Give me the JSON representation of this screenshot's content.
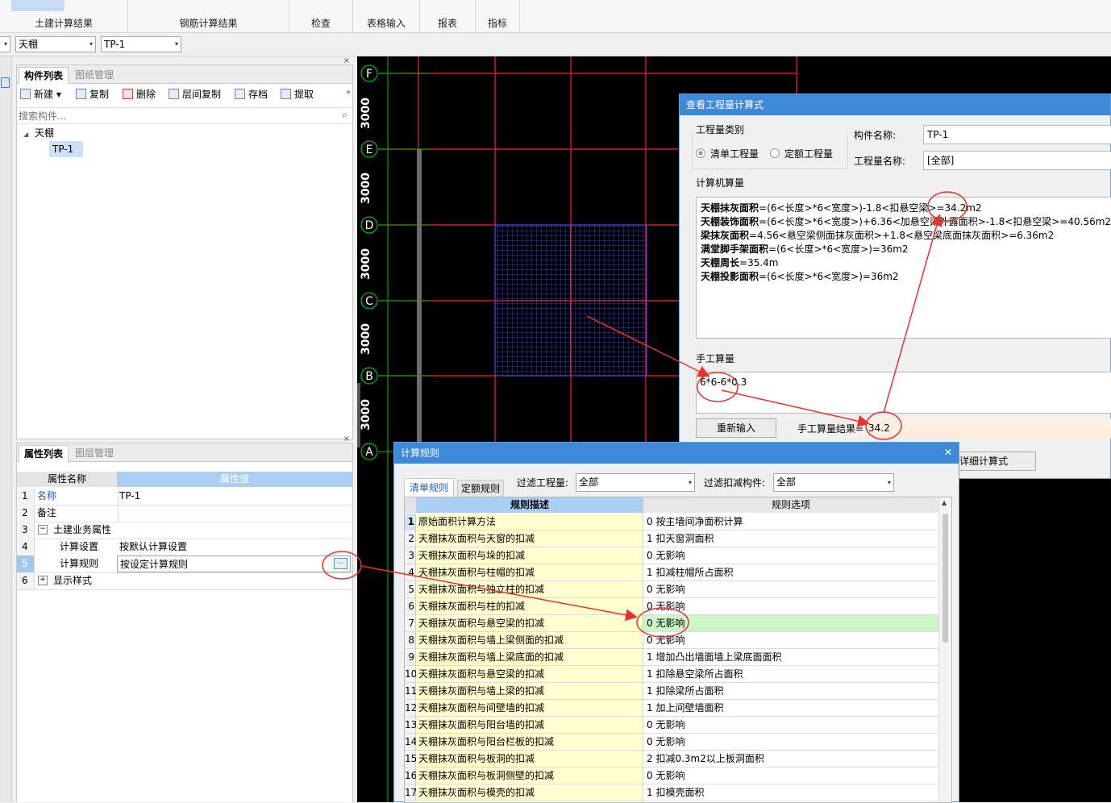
{
  "ribbon": {
    "tabs": [
      "土建计算结果",
      "钢筋计算结果",
      "检查",
      "表格输入",
      "报表",
      "指标"
    ]
  },
  "selectors": {
    "category": "天棚",
    "component": "TP-1"
  },
  "component_panel": {
    "tabs": [
      "构件列表",
      "图纸管理"
    ],
    "toolbar": [
      "新建",
      "复制",
      "删除",
      "层间复制",
      "存档",
      "提取"
    ],
    "search_placeholder": "搜索构件...",
    "tree": {
      "root": "天棚",
      "child": "TP-1"
    }
  },
  "property_panel": {
    "tabs": [
      "属性列表",
      "图层管理"
    ],
    "headers": [
      "属性名称",
      "属性值"
    ],
    "rows": [
      {
        "num": "1",
        "name": "名称",
        "value": "TP-1"
      },
      {
        "num": "2",
        "name": "备注",
        "value": ""
      },
      {
        "num": "3",
        "name": "土建业务属性",
        "value": ""
      },
      {
        "num": "4",
        "name": "计算设置",
        "value": "按默认计算设置"
      },
      {
        "num": "5",
        "name": "计算规则",
        "value": "按设定计算规则"
      },
      {
        "num": "6",
        "name": "显示样式",
        "value": ""
      }
    ],
    "ellipsis": "···"
  },
  "canvas": {
    "axis_labels": [
      "F",
      "E",
      "D",
      "C",
      "B",
      "A"
    ],
    "spacing_labels": [
      "3000",
      "3000",
      "3000",
      "3000",
      "3000"
    ],
    "colors": {
      "grid": "#ff2020",
      "axis": "#00c000",
      "mesh": "#3a4dff"
    }
  },
  "quantity_dialog": {
    "title": "查看工程量计算式",
    "qty_type_label": "工程量类别",
    "radio_list": "清单工程量",
    "radio_quota": "定额工程量",
    "component_name_label": "构件名称:",
    "component_name_value": "TP-1",
    "qty_name_label": "工程量名称:",
    "qty_name_value": "[全部]",
    "computer_label": "计算机算量",
    "formulas": [
      {
        "name": "天棚抹灰面积",
        "expr": "=(6<长度>*6<宽度>)-1.8<扣悬空梁>=34.2m2"
      },
      {
        "name": "天棚装饰面积",
        "expr": "=(6<长度>*6<宽度>)+6.36<加悬空梁外露面积>-1.8<扣悬空梁>=40.56m2"
      },
      {
        "name": "梁抹灰面积",
        "expr": "=4.56<悬空梁侧面抹灰面积>+1.8<悬空梁底面抹灰面积>=6.36m2"
      },
      {
        "name": "满堂脚手架面积",
        "expr": "=(6<长度>*6<宽度>)=36m2"
      },
      {
        "name": "天棚周长",
        "expr": "=35.4m"
      },
      {
        "name": "天棚投影面积",
        "expr": "=(6<长度>*6<宽度>)=36m2"
      }
    ],
    "manual_label": "手工算量",
    "manual_input": "6*6-6*0.3",
    "reinput_button": "重新输入",
    "manual_result_label": "手工算量结果=",
    "manual_result_value": "34.2",
    "detail_button": "示详细计算式"
  },
  "rules_dialog": {
    "title": "计算规则",
    "close": "✕",
    "tabs": [
      "清单规则",
      "定额规则"
    ],
    "filter_qty_label": "过滤工程量:",
    "filter_qty_value": "全部",
    "filter_deduct_label": "过滤扣减构件:",
    "filter_deduct_value": "全部",
    "headers": [
      "规则描述",
      "规则选项"
    ],
    "rows": [
      {
        "num": "1",
        "desc": "原始面积计算方法",
        "opt": "0 按主墙间净面积计算"
      },
      {
        "num": "2",
        "desc": "天棚抹灰面积与天窗的扣减",
        "opt": "1 扣天窗洞面积"
      },
      {
        "num": "3",
        "desc": "天棚抹灰面积与垛的扣减",
        "opt": "0  无影响"
      },
      {
        "num": "4",
        "desc": "天棚抹灰面积与柱帽的扣减",
        "opt": "1 扣减柱帽所占面积"
      },
      {
        "num": "5",
        "desc": "天棚抹灰面积与独立柱的扣减",
        "opt": "0  无影响"
      },
      {
        "num": "6",
        "desc": "天棚抹灰面积与柱的扣减",
        "opt": "0  无影响"
      },
      {
        "num": "7",
        "desc": "天棚抹灰面积与悬空梁的扣减",
        "opt": "0  无影响"
      },
      {
        "num": "8",
        "desc": "天棚抹灰面积与墙上梁侧面的扣减",
        "opt": "0  无影响"
      },
      {
        "num": "9",
        "desc": "天棚抹灰面积与墙上梁底面的扣减",
        "opt": "1 增加凸出墙面墙上梁底面面积"
      },
      {
        "num": "10",
        "desc": "天棚抹灰面积与悬空梁的扣减",
        "opt": "1 扣除悬空梁所占面积"
      },
      {
        "num": "11",
        "desc": "天棚抹灰面积与墙上梁的扣减",
        "opt": "1 扣除梁所占面积"
      },
      {
        "num": "12",
        "desc": "天棚抹灰面积与间壁墙的扣减",
        "opt": "1 加上间壁墙面积"
      },
      {
        "num": "13",
        "desc": "天棚抹灰面积与阳台墙的扣减",
        "opt": "0  无影响"
      },
      {
        "num": "14",
        "desc": "天棚抹灰面积与阳台栏板的扣减",
        "opt": "0  无影响"
      },
      {
        "num": "15",
        "desc": "天棚抹灰面积与板洞的扣减",
        "opt": "2 扣减0.3m2以上板洞面积"
      },
      {
        "num": "16",
        "desc": "天棚抹灰面积与板洞侧壁的扣减",
        "opt": "0  无影响"
      },
      {
        "num": "17",
        "desc": "天棚抹灰面积与模壳的扣减",
        "opt": "1 扣模壳面积"
      }
    ]
  },
  "annotation_color": "#e8322c"
}
